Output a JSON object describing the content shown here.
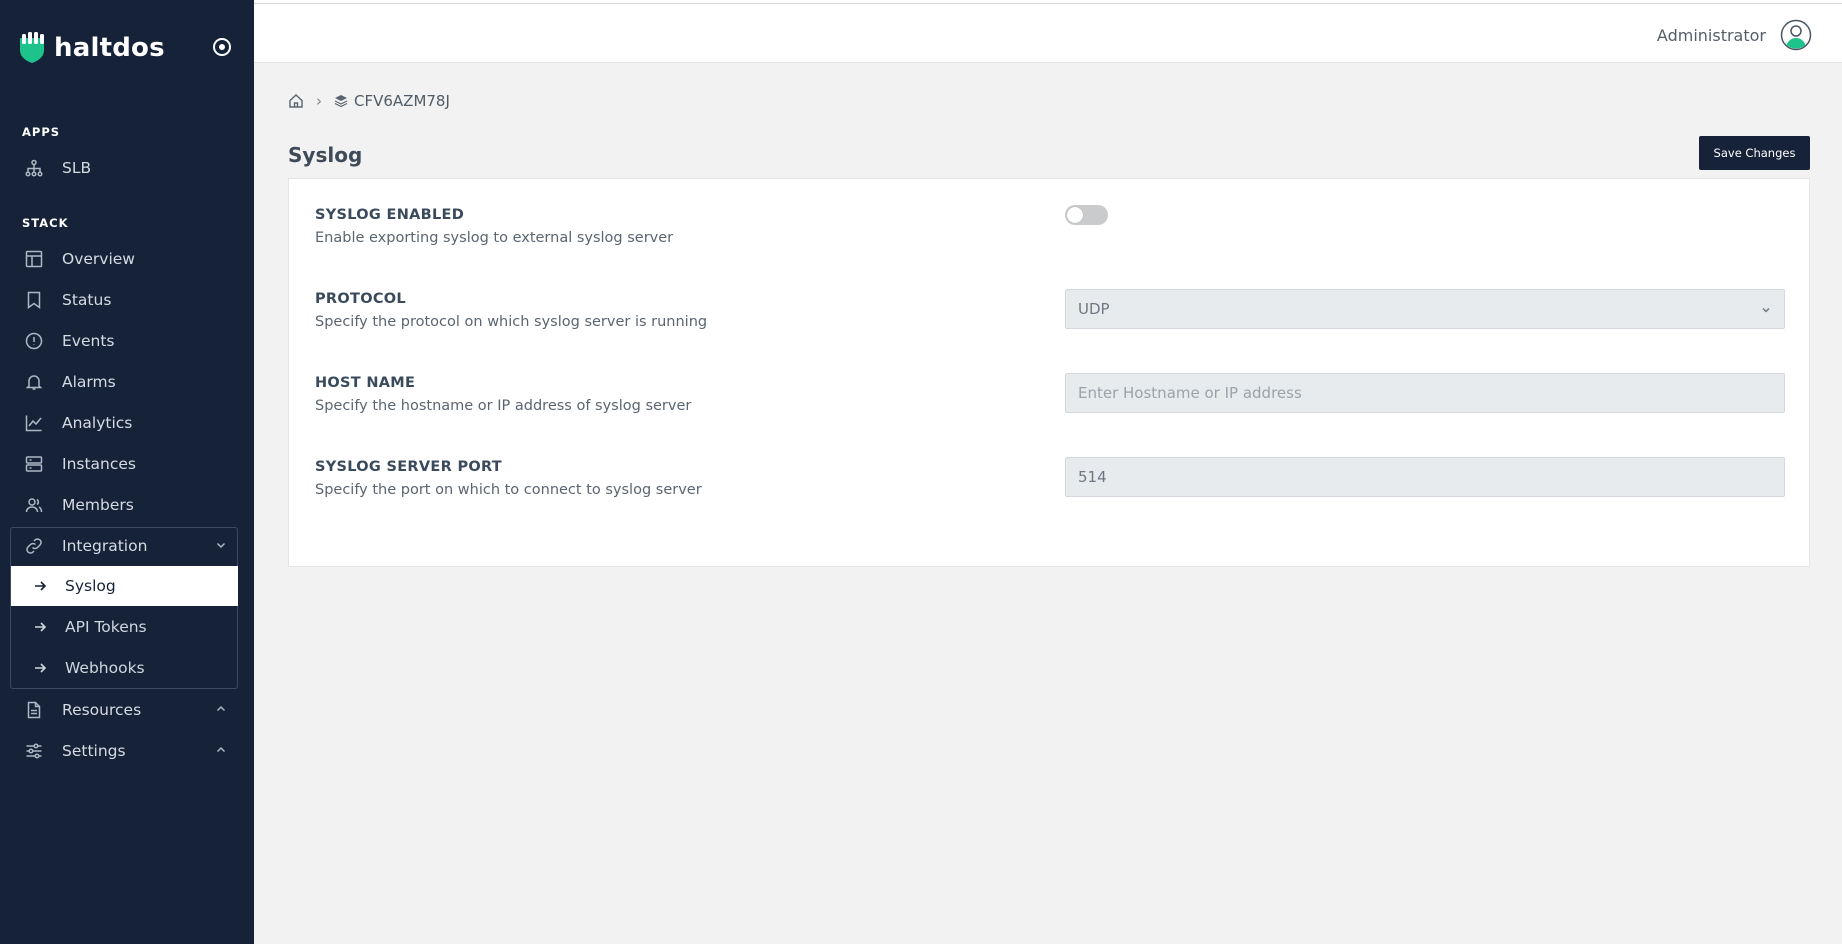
{
  "brand": {
    "name": "haltdos",
    "accent": "#1ec28b"
  },
  "sidebar": {
    "apps_label": "APPS",
    "apps_items": [
      {
        "label": "SLB",
        "icon": "sitemap-icon"
      }
    ],
    "stack_label": "STACK",
    "items": [
      {
        "label": "Overview",
        "icon": "layout-icon"
      },
      {
        "label": "Status",
        "icon": "bookmark-icon"
      },
      {
        "label": "Events",
        "icon": "alert-circle-icon"
      },
      {
        "label": "Alarms",
        "icon": "bell-icon"
      },
      {
        "label": "Analytics",
        "icon": "chart-line-icon"
      },
      {
        "label": "Instances",
        "icon": "server-icon"
      },
      {
        "label": "Members",
        "icon": "users-icon"
      }
    ],
    "integration": {
      "label": "Integration",
      "icon": "link-icon",
      "sub_items": [
        {
          "label": "Syslog",
          "active": true
        },
        {
          "label": "API Tokens",
          "active": false
        },
        {
          "label": "Webhooks",
          "active": false
        }
      ]
    },
    "resources": {
      "label": "Resources",
      "icon": "document-icon"
    },
    "settings": {
      "label": "Settings",
      "icon": "sliders-icon"
    }
  },
  "header": {
    "user_name": "Administrator"
  },
  "breadcrumb": {
    "code": "CFV6AZM78J"
  },
  "page": {
    "title": "Syslog",
    "save_label": "Save Changes"
  },
  "form": {
    "enabled": {
      "title": "SYSLOG ENABLED",
      "desc": "Enable exporting syslog to external syslog server",
      "value": false
    },
    "protocol": {
      "title": "PROTOCOL",
      "desc": "Specify the protocol on which syslog server is running",
      "value": "UDP"
    },
    "hostname": {
      "title": "HOST NAME",
      "desc": "Specify the hostname or IP address of syslog server",
      "placeholder": "Enter Hostname or IP address",
      "value": ""
    },
    "port": {
      "title": "SYSLOG SERVER PORT",
      "desc": "Specify the port on which to connect to syslog server",
      "value": "514"
    }
  }
}
